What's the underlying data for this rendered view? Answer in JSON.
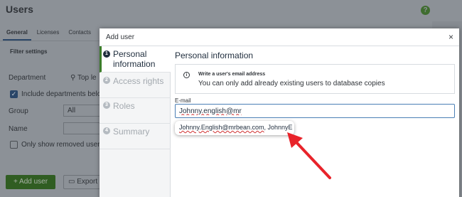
{
  "background": {
    "page_title": "Users",
    "help_icon_glyph": "?",
    "tabs": [
      {
        "label": "General",
        "active": true
      },
      {
        "label": "Licenses",
        "active": false
      },
      {
        "label": "Contacts",
        "active": false
      }
    ],
    "filter_heading": "Filter settings",
    "department_label": "Department",
    "department_value": "Top le",
    "include_departments_label": "Include departments below",
    "group_label": "Group",
    "group_value": "All",
    "name_label": "Name",
    "removed_users_label": "Only show removed users",
    "add_user_button": "+ Add user",
    "export_button": "Export"
  },
  "modal": {
    "title": "Add user",
    "close_glyph": "×",
    "steps": [
      {
        "number": "1",
        "label": "Personal information",
        "active": true
      },
      {
        "number": "2",
        "label": "Access rights",
        "active": false
      },
      {
        "number": "3",
        "label": "Roles",
        "active": false
      },
      {
        "number": "4",
        "label": "Summary",
        "active": false
      }
    ],
    "section_title": "Personal information",
    "info": {
      "icon_glyph": "i",
      "title": "Write a user's email address",
      "text": "You can only add already existing users to database copies"
    },
    "email": {
      "label": "E-mail",
      "value": "Johnny.english@mr"
    },
    "suggestion": {
      "email": "Johnny.English@mrbean.com",
      "rest": ", JohnnyE"
    }
  },
  "colors": {
    "accent_green": "#3c7d2a",
    "navy": "#1f2d3d",
    "focus_blue": "#4b7fb5",
    "annotation_red": "#e8232a"
  }
}
